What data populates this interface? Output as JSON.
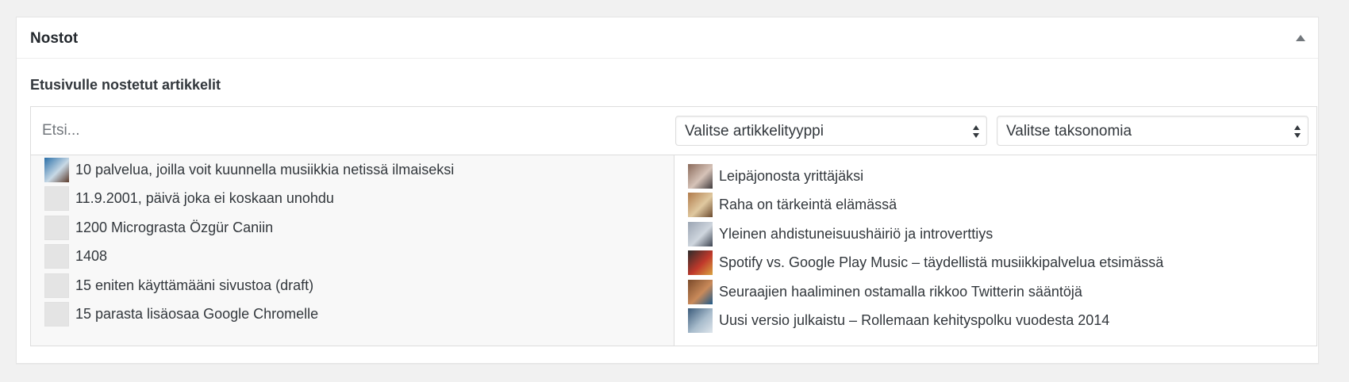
{
  "metabox": {
    "title": "Nostot",
    "toggle_icon": "triangle-up-icon"
  },
  "section": {
    "label": "Etusivulle nostetut artikkelit"
  },
  "search": {
    "placeholder": "Etsi...",
    "value": ""
  },
  "filters": {
    "type_select": "Valitse artikkelityyppi",
    "taxonomy_select": "Valitse taksonomia"
  },
  "available_items": [
    {
      "label": "10 palvelua, joilla voit kuunnella musiikkia netissä ilmaiseksi",
      "thumb": "photo",
      "colors": [
        "#2a6fa8",
        "#c8d9e6",
        "#5b3a2a"
      ]
    },
    {
      "label": "11.9.2001, päivä joka ei koskaan unohdu",
      "thumb": "none"
    },
    {
      "label": "1200 Micrograsta Özgür Caniin",
      "thumb": "none"
    },
    {
      "label": "1408",
      "thumb": "none"
    },
    {
      "label": "15 eniten käyttämääni sivustoa (draft)",
      "thumb": "none"
    },
    {
      "label": "15 parasta lisäosaa Google Chromelle",
      "thumb": "none"
    }
  ],
  "selected_items": [
    {
      "label": "Leipäjonosta yrittäjäksi",
      "thumb": "photo",
      "colors": [
        "#8a6a5a",
        "#d6c3b8",
        "#3f3a3c"
      ]
    },
    {
      "label": "Raha on tärkeintä elämässä",
      "thumb": "photo",
      "colors": [
        "#b07a4a",
        "#e0c9a0",
        "#6b4a2e"
      ]
    },
    {
      "label": "Yleinen ahdistuneisuushäiriö ja introverttiys",
      "thumb": "photo",
      "colors": [
        "#9aa4b2",
        "#cfd6de",
        "#3c4350"
      ]
    },
    {
      "label": "Spotify vs. Google Play Music – täydellistä musiikkipalvelua etsimässä",
      "thumb": "photo",
      "colors": [
        "#2b2b2b",
        "#c0392b",
        "#d9a441"
      ]
    },
    {
      "label": "Seuraajien haaliminen ostamalla rikkoo Twitterin sääntöjä",
      "thumb": "photo",
      "colors": [
        "#7a4a2a",
        "#c98a5a",
        "#1f5a8a"
      ]
    },
    {
      "label": "Uusi versio julkaistu – Rollemaan kehityspolku vuodesta 2014",
      "thumb": "photo",
      "colors": [
        "#3a5a7a",
        "#a8bccc",
        "#dfe6ec"
      ]
    }
  ]
}
